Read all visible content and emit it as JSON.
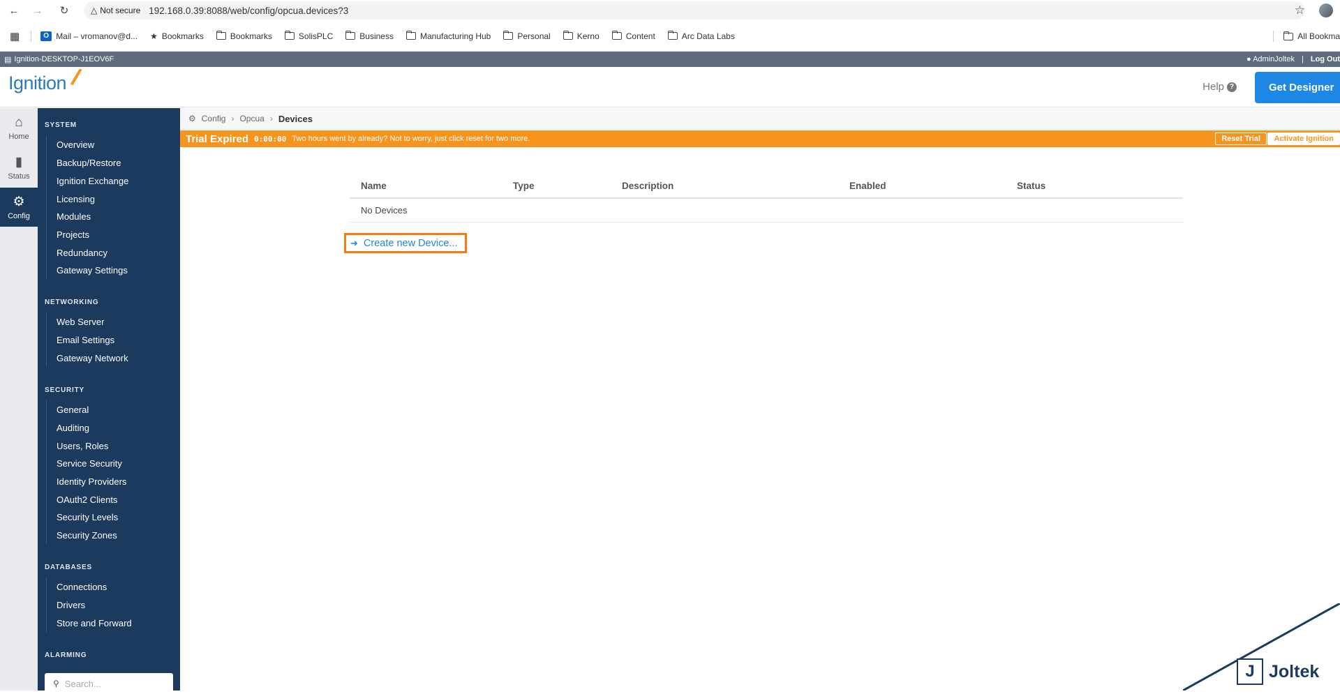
{
  "browser": {
    "security_label": "Not secure",
    "url": "192.168.0.39:8088/web/config/opcua.devices?3",
    "bookmarks": [
      "Mail – vromanov@d...",
      "Bookmarks",
      "Bookmarks",
      "SolisPLC",
      "Business",
      "Manufacturing Hub",
      "Personal",
      "Kerno",
      "Content",
      "Arc Data Labs"
    ],
    "all_bookmarks": "All Bookma"
  },
  "gateway": {
    "name": "Ignition-DESKTOP-J1EOV6F",
    "user": "AdminJoltek",
    "logout": "Log Out"
  },
  "header": {
    "logo": "Ignition",
    "help": "Help",
    "get_designer": "Get Designer"
  },
  "rail": {
    "home": "Home",
    "status": "Status",
    "config": "Config"
  },
  "sidebar": {
    "system_title": "SYSTEM",
    "system": [
      "Overview",
      "Backup/Restore",
      "Ignition Exchange",
      "Licensing",
      "Modules",
      "Projects",
      "Redundancy",
      "Gateway Settings"
    ],
    "networking_title": "NETWORKING",
    "networking": [
      "Web Server",
      "Email Settings",
      "Gateway Network"
    ],
    "security_title": "SECURITY",
    "security": [
      "General",
      "Auditing",
      "Users, Roles",
      "Service Security",
      "Identity Providers",
      "OAuth2 Clients",
      "Security Levels",
      "Security Zones"
    ],
    "databases_title": "DATABASES",
    "databases": [
      "Connections",
      "Drivers",
      "Store and Forward"
    ],
    "alarming_title": "ALARMING",
    "search_placeholder": "Search..."
  },
  "breadcrumb": {
    "config": "Config",
    "opcua": "Opcua",
    "current": "Devices"
  },
  "trial": {
    "title": "Trial Expired",
    "time": "0:00:00",
    "message": "Two hours went by already? Not to worry, just click reset for two more.",
    "reset": "Reset Trial",
    "activate": "Activate Ignition"
  },
  "table": {
    "headers": [
      "Name",
      "Type",
      "Description",
      "Enabled",
      "Status"
    ],
    "empty_message": "No Devices"
  },
  "create_link": "Create new Device...",
  "watermark": "Joltek",
  "colors": {
    "sidebar": "#1c3a5e",
    "trial": "#f7941d",
    "accent": "#1e87e5",
    "highlight": "#f07c13"
  }
}
